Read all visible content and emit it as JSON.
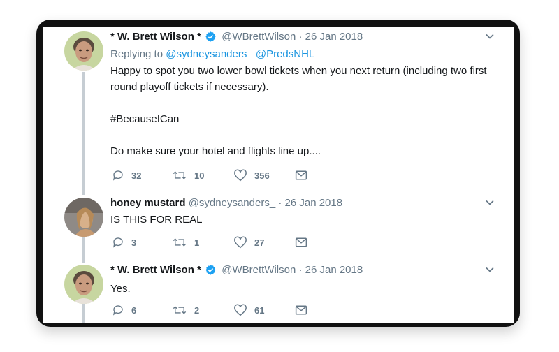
{
  "tweets": [
    {
      "author_name": "* W. Brett Wilson *",
      "handle": "@WBrettWilson",
      "separator": "·",
      "date": "26 Jan 2018",
      "replying_label": "Replying to",
      "reply_handles": "@sydneysanders_ @PredsNHL",
      "text": "Happy to spot you two lower bowl tickets when you next return (including two first round playoff tickets if necessary).\n\n#BecauseICan\n\nDo make sure your hotel and flights line up....",
      "replies": "32",
      "retweets": "10",
      "likes": "356",
      "verified": true
    },
    {
      "author_name": "honey mustard",
      "handle": "@sydneysanders_",
      "separator": "·",
      "date": "26 Jan 2018",
      "text": "IS THIS FOR REAL",
      "replies": "3",
      "retweets": "1",
      "likes": "27",
      "verified": false
    },
    {
      "author_name": "* W. Brett Wilson *",
      "handle": "@WBrettWilson",
      "separator": "·",
      "date": "26 Jan 2018",
      "text": "Yes.",
      "replies": "6",
      "retweets": "2",
      "likes": "61",
      "verified": true
    }
  ],
  "colors": {
    "verified": "#1da1f2",
    "link": "#1b95e0",
    "muted": "#657786",
    "thread_line": "#c6cdd3"
  },
  "icons": [
    "reply-icon",
    "retweet-icon",
    "like-icon",
    "direct-message-icon",
    "chevron-down-icon",
    "verified-badge-icon"
  ]
}
